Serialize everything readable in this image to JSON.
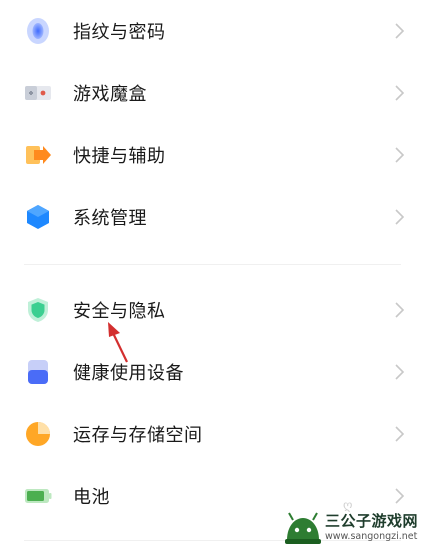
{
  "settings": {
    "items": [
      {
        "label": "指纹与密码",
        "icon": "fingerprint-icon"
      },
      {
        "label": "游戏魔盒",
        "icon": "game-box-icon"
      },
      {
        "label": "快捷与辅助",
        "icon": "shortcut-arrow-icon"
      },
      {
        "label": "系统管理",
        "icon": "system-hexagon-icon"
      },
      {
        "label": "安全与隐私",
        "icon": "shield-icon"
      },
      {
        "label": "健康使用设备",
        "icon": "device-health-icon"
      },
      {
        "label": "运存与存储空间",
        "icon": "storage-pie-icon"
      },
      {
        "label": "电池",
        "icon": "battery-icon"
      }
    ]
  },
  "colors": {
    "label_text": "#1a1a1a",
    "chevron": "#c8c8c8",
    "annotation_arrow": "#d32f2f",
    "fingerprint": "#3f6bff",
    "game_box": "#e05a4a",
    "shortcut": "#ff9a2e",
    "system": "#1e88ff",
    "shield": "#3ccf91",
    "device": "#4a6cf7",
    "storage": "#ffa726",
    "battery": "#4caf50"
  },
  "watermark": {
    "title": "三公子游戏网",
    "url": "www.sangongzi.net"
  }
}
